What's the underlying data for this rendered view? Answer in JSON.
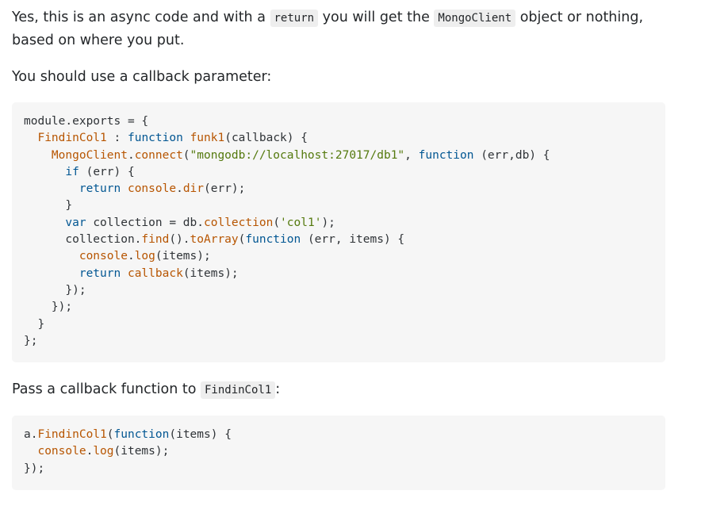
{
  "answer": {
    "p1": {
      "before": "Yes, this is an async code and with a ",
      "code1": "return",
      "middle": " you will get the ",
      "code2": "MongoClient",
      "after": " object or nothing, based on where you put."
    },
    "p2": "You should use a callback parameter:",
    "p3": {
      "before": "Pass a callback function to ",
      "code": "FindinCol1",
      "after": ":"
    },
    "code_block_1": [
      [
        {
          "t": "pl",
          "s": "module.exports = {"
        }
      ],
      [
        {
          "t": "pl",
          "s": "  "
        },
        {
          "t": "fn",
          "s": "FindinCol1"
        },
        {
          "t": "pl",
          "s": " : "
        },
        {
          "t": "kw",
          "s": "function"
        },
        {
          "t": "pl",
          "s": " "
        },
        {
          "t": "fn",
          "s": "funk1"
        },
        {
          "t": "pl",
          "s": "(callback) {"
        }
      ],
      [
        {
          "t": "pl",
          "s": "    "
        },
        {
          "t": "fn",
          "s": "MongoClient"
        },
        {
          "t": "pl",
          "s": "."
        },
        {
          "t": "fn",
          "s": "connect"
        },
        {
          "t": "pl",
          "s": "("
        },
        {
          "t": "st",
          "s": "\"mongodb://localhost:27017/db1\""
        },
        {
          "t": "pl",
          "s": ", "
        },
        {
          "t": "kw",
          "s": "function"
        },
        {
          "t": "pl",
          "s": " (err,db) {"
        }
      ],
      [
        {
          "t": "pl",
          "s": "      "
        },
        {
          "t": "kw",
          "s": "if"
        },
        {
          "t": "pl",
          "s": " (err) {"
        }
      ],
      [
        {
          "t": "pl",
          "s": "        "
        },
        {
          "t": "kw",
          "s": "return"
        },
        {
          "t": "pl",
          "s": " "
        },
        {
          "t": "fn",
          "s": "console"
        },
        {
          "t": "pl",
          "s": "."
        },
        {
          "t": "fn",
          "s": "dir"
        },
        {
          "t": "pl",
          "s": "(err);"
        }
      ],
      [
        {
          "t": "pl",
          "s": "      }"
        }
      ],
      [
        {
          "t": "pl",
          "s": "      "
        },
        {
          "t": "kw",
          "s": "var"
        },
        {
          "t": "pl",
          "s": " collection = db."
        },
        {
          "t": "fn",
          "s": "collection"
        },
        {
          "t": "pl",
          "s": "("
        },
        {
          "t": "st",
          "s": "'col1'"
        },
        {
          "t": "pl",
          "s": ");"
        }
      ],
      [
        {
          "t": "pl",
          "s": "      collection."
        },
        {
          "t": "fn",
          "s": "find"
        },
        {
          "t": "pl",
          "s": "()."
        },
        {
          "t": "fn",
          "s": "toArray"
        },
        {
          "t": "pl",
          "s": "("
        },
        {
          "t": "kw",
          "s": "function"
        },
        {
          "t": "pl",
          "s": " (err, items) {"
        }
      ],
      [
        {
          "t": "pl",
          "s": "        "
        },
        {
          "t": "fn",
          "s": "console"
        },
        {
          "t": "pl",
          "s": "."
        },
        {
          "t": "fn",
          "s": "log"
        },
        {
          "t": "pl",
          "s": "(items);"
        }
      ],
      [
        {
          "t": "pl",
          "s": "        "
        },
        {
          "t": "kw",
          "s": "return"
        },
        {
          "t": "pl",
          "s": " "
        },
        {
          "t": "fn",
          "s": "callback"
        },
        {
          "t": "pl",
          "s": "(items);"
        }
      ],
      [
        {
          "t": "pl",
          "s": "      });"
        }
      ],
      [
        {
          "t": "pl",
          "s": "    });"
        }
      ],
      [
        {
          "t": "pl",
          "s": "  }"
        }
      ],
      [
        {
          "t": "pl",
          "s": "};"
        }
      ]
    ],
    "code_block_2": [
      [
        {
          "t": "pl",
          "s": "a."
        },
        {
          "t": "fn",
          "s": "FindinCol1"
        },
        {
          "t": "pl",
          "s": "("
        },
        {
          "t": "kw",
          "s": "function"
        },
        {
          "t": "pl",
          "s": "(items) {"
        }
      ],
      [
        {
          "t": "pl",
          "s": "  "
        },
        {
          "t": "fn",
          "s": "console"
        },
        {
          "t": "pl",
          "s": "."
        },
        {
          "t": "fn",
          "s": "log"
        },
        {
          "t": "pl",
          "s": "(items);"
        }
      ],
      [
        {
          "t": "pl",
          "s": "});"
        }
      ]
    ],
    "colors": {
      "text": "#232629",
      "code_bg": "#f6f6f6",
      "inline_code_bg": "#eeeeee",
      "token_function_name": "#b75501",
      "token_keyword": "#015692",
      "token_string": "#54790d"
    }
  }
}
